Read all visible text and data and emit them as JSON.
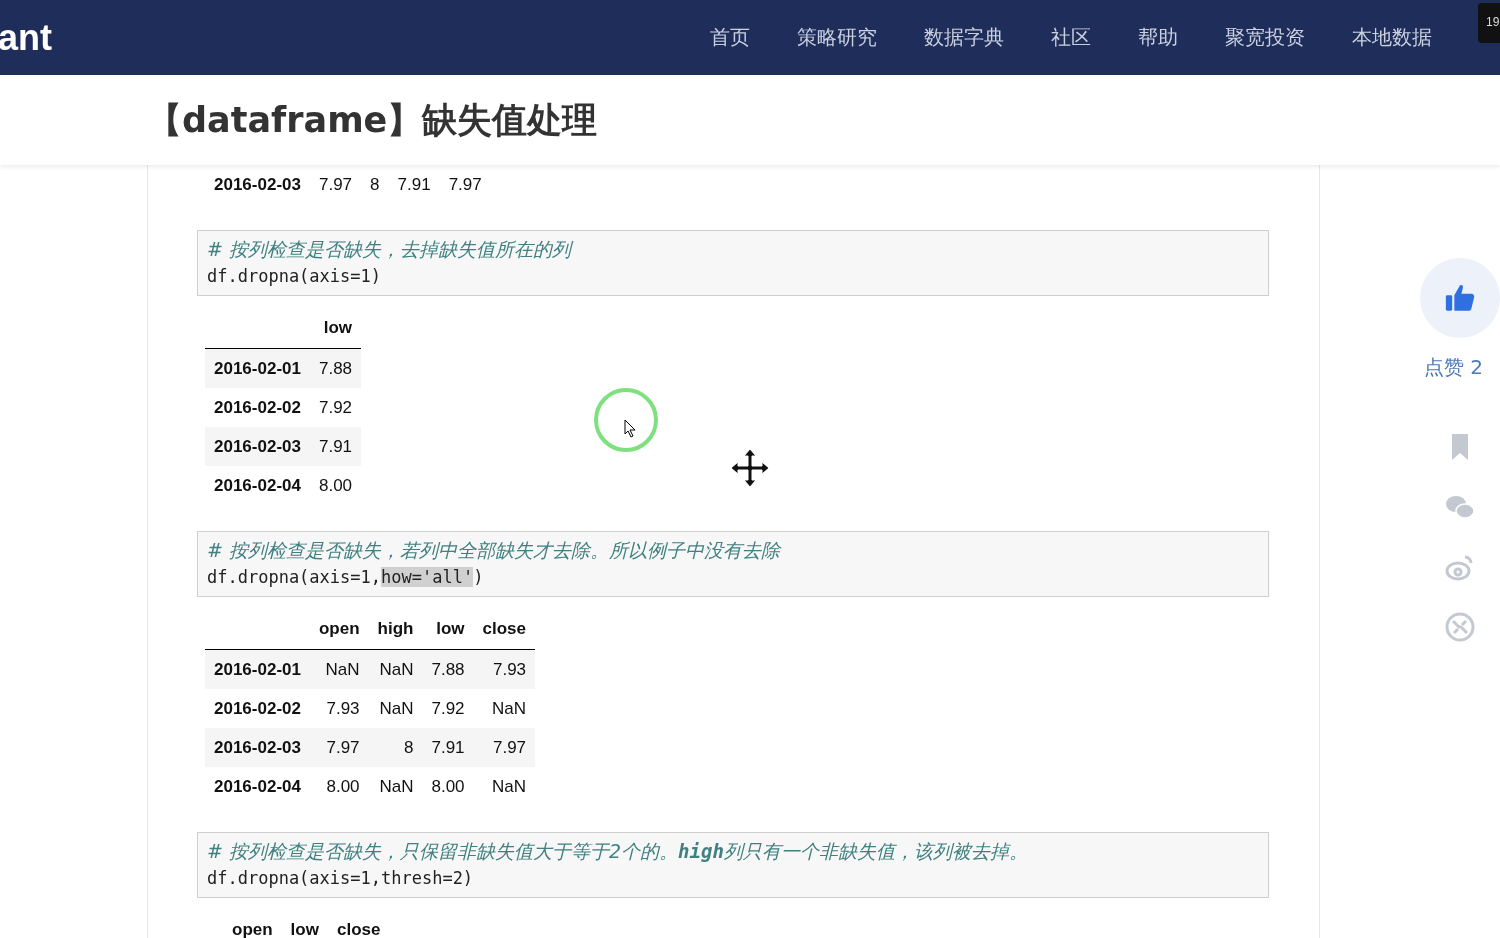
{
  "header": {
    "logo": "ant",
    "nav": [
      "首页",
      "策略研究",
      "数据字典",
      "社区",
      "帮助",
      "聚宽投资",
      "本地数据"
    ],
    "badge": "19"
  },
  "title": "【dataframe】缺失值处理",
  "blocks": [
    {
      "kind": "table",
      "rows": [
        {
          "index": "2016-02-03",
          "cells": [
            "7.97",
            "8",
            "7.91",
            "7.97"
          ]
        }
      ]
    },
    {
      "kind": "code",
      "comment": "#  按列检查是否缺失，去掉缺失值所在的列",
      "code": [
        {
          "text": "df.dropna(axis=1)",
          "highlighted": false
        }
      ]
    },
    {
      "kind": "table",
      "columns": [
        "low"
      ],
      "rows": [
        {
          "index": "2016-02-01",
          "cells": [
            "7.88"
          ]
        },
        {
          "index": "2016-02-02",
          "cells": [
            "7.92"
          ]
        },
        {
          "index": "2016-02-03",
          "cells": [
            "7.91"
          ]
        },
        {
          "index": "2016-02-04",
          "cells": [
            "8.00"
          ]
        }
      ]
    },
    {
      "kind": "code",
      "comment": "#  按列检查是否缺失，若列中全部缺失才去除。所以例子中没有去除",
      "code": [
        {
          "text": "df.dropna(axis=1,",
          "highlighted": false
        },
        {
          "text": "how='all'",
          "highlighted": true
        },
        {
          "text": ")",
          "highlighted": false
        }
      ]
    },
    {
      "kind": "table",
      "columns": [
        "open",
        "high",
        "low",
        "close"
      ],
      "rows": [
        {
          "index": "2016-02-01",
          "cells": [
            "NaN",
            "NaN",
            "7.88",
            "7.93"
          ]
        },
        {
          "index": "2016-02-02",
          "cells": [
            "7.93",
            "NaN",
            "7.92",
            "NaN"
          ]
        },
        {
          "index": "2016-02-03",
          "cells": [
            "7.97",
            "8",
            "7.91",
            "7.97"
          ]
        },
        {
          "index": "2016-02-04",
          "cells": [
            "8.00",
            "NaN",
            "8.00",
            "NaN"
          ]
        }
      ]
    },
    {
      "kind": "code",
      "comment": "#  按列检查是否缺失，只保留非缺失值大于等于2个的。**high**列只有一个非缺失值，该列被去掉。",
      "code": [
        {
          "text": "df.dropna(axis=1,thresh=2)",
          "highlighted": false
        }
      ]
    },
    {
      "kind": "table",
      "columns": [
        "open",
        "low",
        "close"
      ]
    }
  ],
  "sidebar": {
    "like_label": "点赞 2"
  }
}
